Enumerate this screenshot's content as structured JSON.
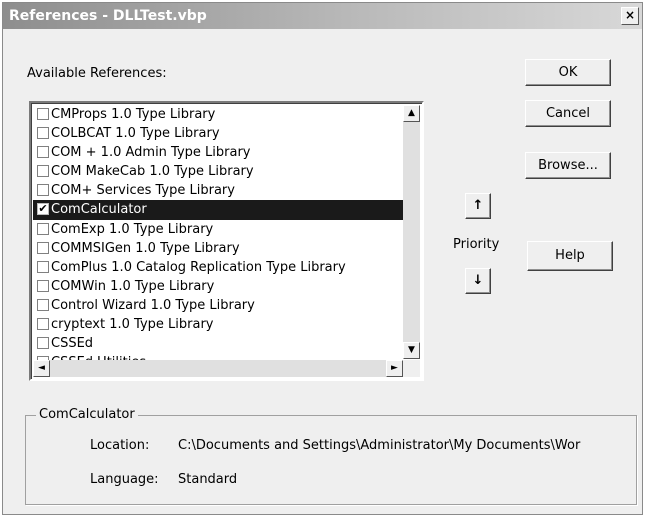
{
  "window": {
    "title": "References - DLLTest.vbp",
    "close_glyph": "×"
  },
  "available_label": "Available References:",
  "references": [
    {
      "label": "CMProps 1.0 Type Library",
      "checked": false
    },
    {
      "label": "COLBCAT 1.0 Type Library",
      "checked": false
    },
    {
      "label": "COM + 1.0 Admin Type Library",
      "checked": false
    },
    {
      "label": "COM MakeCab 1.0 Type Library",
      "checked": false
    },
    {
      "label": "COM+ Services Type Library",
      "checked": false
    },
    {
      "label": "ComCalculator",
      "checked": true,
      "selected": true
    },
    {
      "label": "ComExp 1.0 Type Library",
      "checked": false
    },
    {
      "label": "COMMSIGen 1.0 Type Library",
      "checked": false
    },
    {
      "label": "ComPlus 1.0 Catalog Replication Type Library",
      "checked": false
    },
    {
      "label": "COMWin 1.0 Type Library",
      "checked": false
    },
    {
      "label": "Control Wizard 1.0 Type Library",
      "checked": false
    },
    {
      "label": "cryptext 1.0 Type Library",
      "checked": false
    },
    {
      "label": "CSSEd",
      "checked": false
    },
    {
      "label": "CSSEd Utilities",
      "checked": false
    }
  ],
  "buttons": {
    "ok": "OK",
    "cancel": "Cancel",
    "browse": "Browse...",
    "help": "Help"
  },
  "priority": {
    "label": "Priority",
    "up_glyph": "↑",
    "down_glyph": "↓"
  },
  "scroll_glyphs": {
    "up": "▲",
    "down": "▼",
    "left": "◄",
    "right": "►"
  },
  "details": {
    "title": "ComCalculator",
    "location_label": "Location:",
    "location_value": "C:\\Documents and Settings\\Administrator\\My Documents\\Wor",
    "language_label": "Language:",
    "language_value": "Standard"
  }
}
